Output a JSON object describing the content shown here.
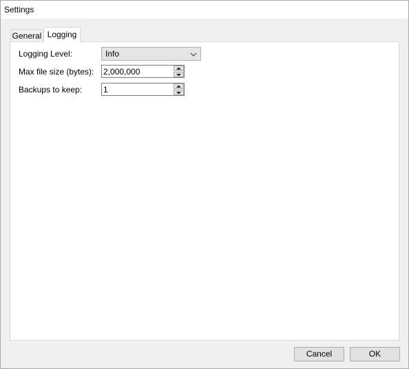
{
  "window": {
    "title": "Settings"
  },
  "tabs": [
    {
      "label": "General",
      "selected": false
    },
    {
      "label": "Logging",
      "selected": true
    }
  ],
  "logging": {
    "level_label": "Logging Level:",
    "level_value": "Info",
    "max_size_label": "Max file size (bytes):",
    "max_size_value": "2,000,000",
    "backups_label": "Backups to keep:",
    "backups_value": "1"
  },
  "buttons": {
    "cancel": "Cancel",
    "ok": "OK"
  },
  "icons": {
    "combo": "chevron-down-icon",
    "spin_up": "spin-up-arrow-icon",
    "spin_down": "spin-down-arrow-icon"
  }
}
